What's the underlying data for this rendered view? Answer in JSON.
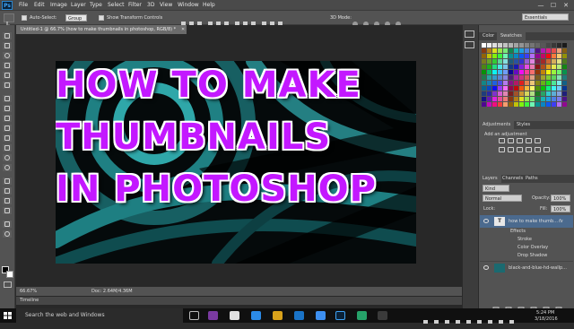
{
  "app": {
    "logo": "Ps"
  },
  "menus": [
    "File",
    "Edit",
    "Image",
    "Layer",
    "Type",
    "Select",
    "Filter",
    "3D",
    "View",
    "Window",
    "Help"
  ],
  "window_controls": [
    "—",
    "☐",
    "✕"
  ],
  "options": {
    "auto_select_label": "Auto-Select:",
    "auto_select_value": "Group",
    "transform_label": "Show Transform Controls",
    "mode_label": "3D Mode:",
    "workspace": "Essentials"
  },
  "document": {
    "tab_title": "Untitled-1 @ 66.7% (how to make thumbnails in photoshop, RGB/8) *",
    "zoom": "66.67%",
    "doc_size": "Doc: 2.64M/4.36M",
    "title_lines": [
      "HOW TO MAKE",
      "THUMBNAILS",
      "IN PHOTOSHOP"
    ]
  },
  "timeline_label": "Timeline",
  "panels": {
    "color_tabs": [
      "Color",
      "Swatches"
    ],
    "adjust_tabs": [
      "Adjustments",
      "Styles"
    ],
    "adjust_heading": "Add an adjustment",
    "layer_tabs": [
      "Layers",
      "Channels",
      "Paths"
    ],
    "kind_label": "Kind",
    "blend_mode": "Normal",
    "opacity_label": "Opacity:",
    "opacity_value": "100%",
    "lock_label": "Lock:",
    "fill_label": "Fill:",
    "fill_value": "100%",
    "layers": [
      {
        "name": "how to make thumb...",
        "fx": "fx"
      },
      {
        "name": "Effects"
      },
      {
        "name": "Stroke"
      },
      {
        "name": "Color Overlay"
      },
      {
        "name": "Drop Shadow"
      },
      {
        "name": "black-and-blue-hd-wallp..."
      }
    ],
    "colors": {
      "accent_text": "#c318ff",
      "selected_layer": "#4b6a8e"
    }
  },
  "taskbar": {
    "search_placeholder": "Search the web and Windows",
    "time": "5:24 PM",
    "date": "3/18/2016"
  }
}
